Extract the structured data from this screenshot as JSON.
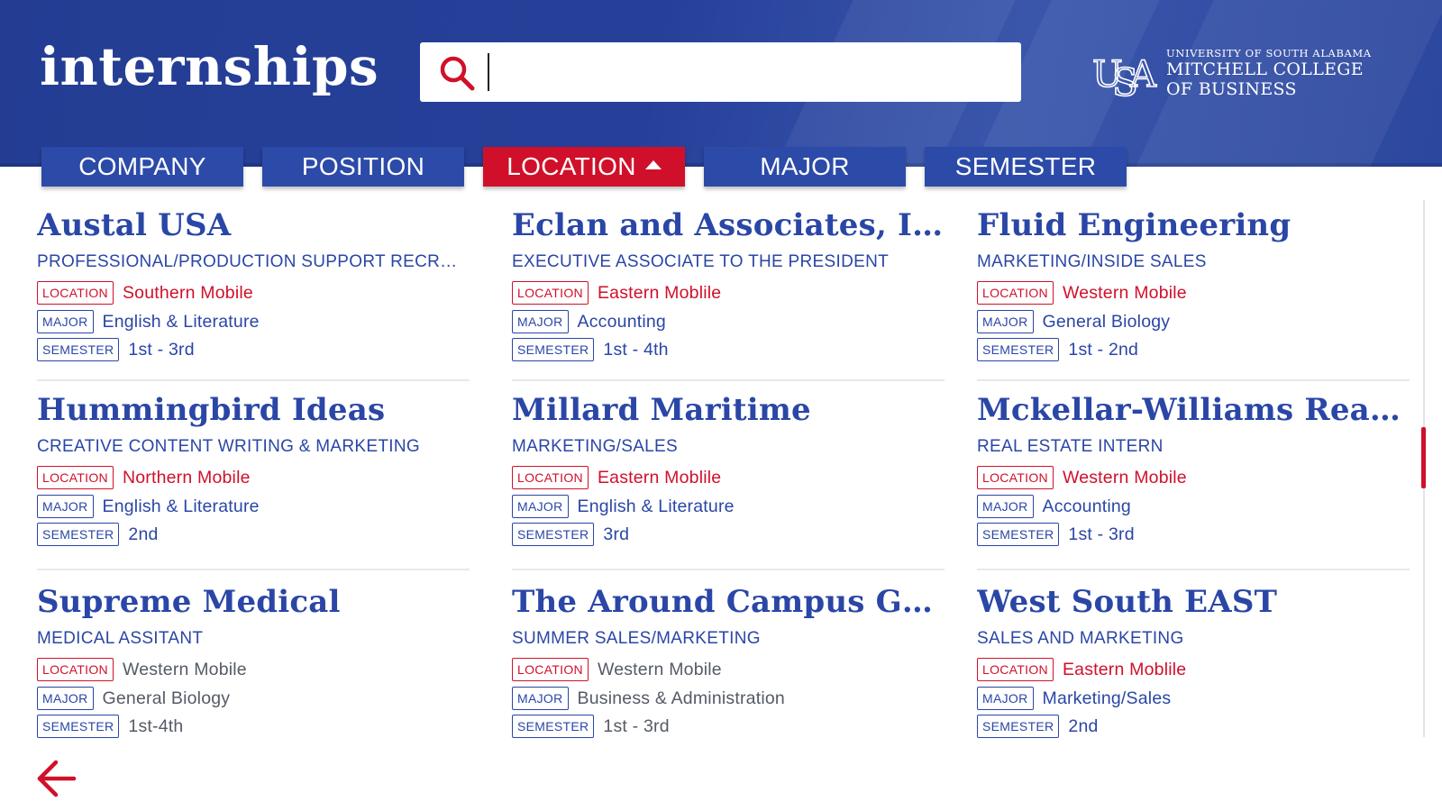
{
  "header": {
    "title": "internships",
    "search": {
      "value": "",
      "placeholder": ""
    },
    "brand": {
      "line1": "UNIVERSITY OF SOUTH ALABAMA",
      "line2": "MITCHELL COLLEGE",
      "line3": "OF BUSINESS",
      "logo_icon": "usa-monogram-icon"
    }
  },
  "tabs": [
    {
      "label": "COMPANY",
      "active": false
    },
    {
      "label": "POSITION",
      "active": false
    },
    {
      "label": "LOCATION",
      "active": true,
      "sort_icon": "sort-ascending-triangle-icon"
    },
    {
      "label": "MAJOR",
      "active": false
    },
    {
      "label": "SEMESTER",
      "active": false
    }
  ],
  "tag_labels": {
    "location": "LOCATION",
    "major": "MAJOR",
    "semester": "SEMESTER"
  },
  "listings": [
    {
      "company": "Austal USA",
      "position": "PROFESSIONAL/PRODUCTION SUPPORT RECRUITER",
      "location": "Southern Mobile",
      "major": "English & Literature",
      "semester": "1st - 3rd",
      "highlight": true
    },
    {
      "company": "Eclan and Associates, Inc.",
      "position": "EXECUTIVE ASSOCIATE TO THE PRESIDENT",
      "location": "Eastern Moblile",
      "major": "Accounting",
      "semester": "1st - 4th",
      "highlight": true
    },
    {
      "company": "Fluid Engineering",
      "position": "MARKETING/INSIDE SALES",
      "location": "Western Mobile",
      "major": "General Biology",
      "semester": "1st - 2nd",
      "highlight": true
    },
    {
      "company": "Hummingbird Ideas",
      "position": "CREATIVE CONTENT WRITING & MARKETING",
      "location": "Northern Mobile",
      "major": "English & Literature",
      "semester": "2nd",
      "highlight": true
    },
    {
      "company": "Millard Maritime",
      "position": "MARKETING/SALES",
      "location": "Eastern Moblile",
      "major": "English & Literature",
      "semester": "3rd",
      "highlight": true
    },
    {
      "company": "Mckellar-Williams Realty",
      "position": "REAL ESTATE INTERN",
      "location": "Western Mobile",
      "major": "Accounting",
      "semester": "1st - 3rd",
      "highlight": true
    },
    {
      "company": "Supreme Medical",
      "position": "MEDICAL ASSITANT",
      "location": "Western Mobile",
      "major": "General Biology",
      "semester": "1st-4th",
      "highlight": false
    },
    {
      "company": "The Around Campus Group",
      "position": "SUMMER SALES/MARKETING",
      "location": "Western Mobile",
      "major": "Business & Administration",
      "semester": "1st - 3rd",
      "highlight": false
    },
    {
      "company": "West South EAST",
      "position": "SALES AND MARKETING",
      "location": "Eastern Moblile",
      "major": "Marketing/Sales",
      "semester": "2nd",
      "highlight": true
    }
  ],
  "footer": {
    "back_icon": "arrow-left-icon"
  },
  "colors": {
    "brand_blue": "#2a46a6",
    "header_blue": "#26409a",
    "accent_red": "#d0102a",
    "white": "#ffffff"
  }
}
